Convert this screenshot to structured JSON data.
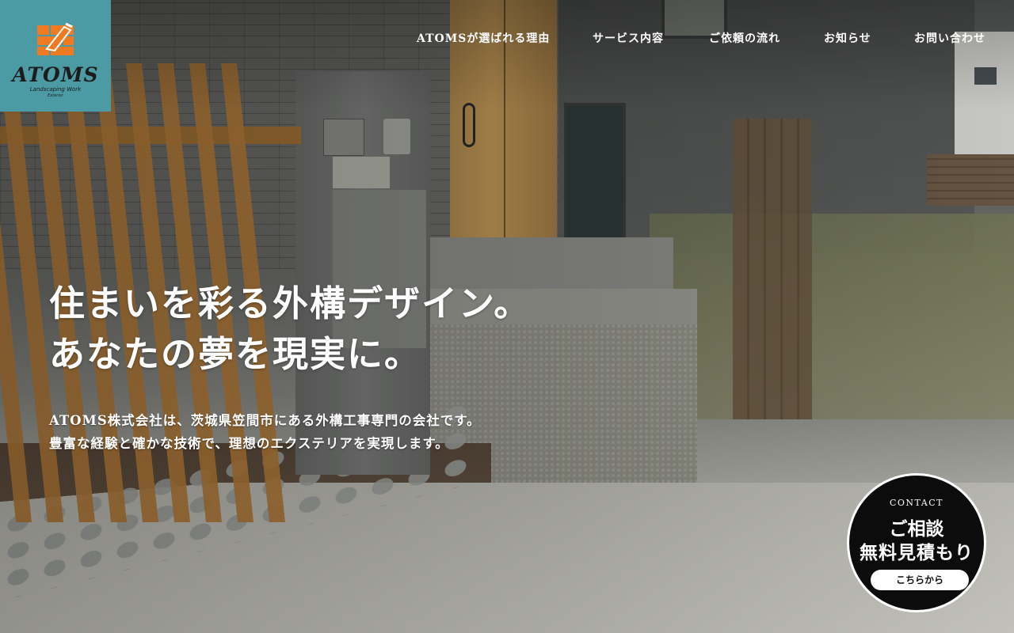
{
  "brand": {
    "name": "ATOMS",
    "tagline": "Landscaping Work",
    "sub": "Exterior",
    "color": "#4c9aa3",
    "mark_color": "#ef7a21"
  },
  "nav": {
    "items": [
      {
        "label": "ATOMSが選ばれる理由"
      },
      {
        "label": "サービス内容"
      },
      {
        "label": "ご依頼の流れ"
      },
      {
        "label": "お知らせ"
      },
      {
        "label": "お問い合わせ"
      }
    ]
  },
  "hero": {
    "line1": "住まいを彩る外構デザイン。",
    "line2": "あなたの夢を現実に。",
    "lead1": "ATOMS株式会社は、茨城県笠間市にある外構工事専門の会社です。",
    "lead2": "豊富な経験と確かな技術で、理想のエクステリアを実現します。"
  },
  "contact": {
    "eyebrow": "CONTACT",
    "line1": "ご相談",
    "line2": "無料見積もり",
    "button": "こちらから"
  }
}
